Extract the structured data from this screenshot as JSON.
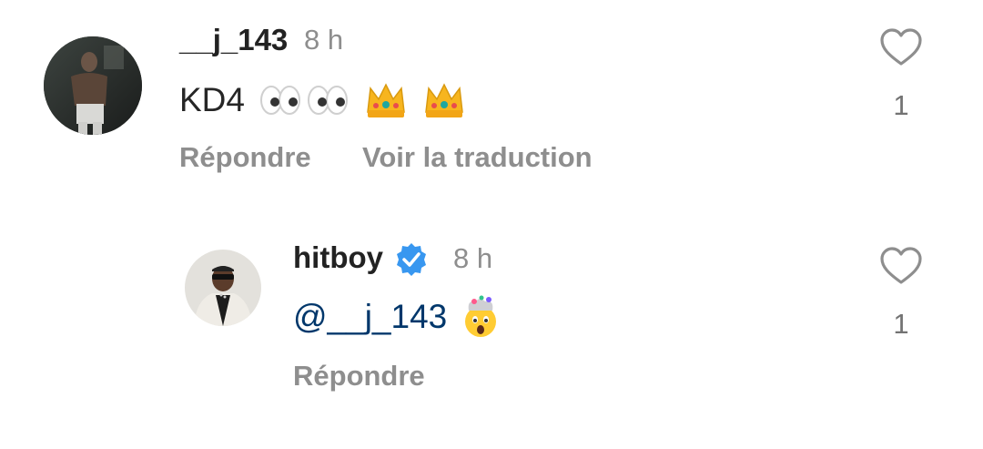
{
  "comments": [
    {
      "username": "__j_143",
      "time": "8 h",
      "text": "KD4",
      "emojis": [
        "eyes-emoji",
        "eyes-emoji",
        "crown-emoji",
        "crown-emoji"
      ],
      "reply_label": "Répondre",
      "translate_label": "Voir la traduction",
      "likes": "1",
      "verified": false
    },
    {
      "username": "hitboy",
      "time": "8 h",
      "mention": "@__j_143",
      "emojis": [
        "exploding-head-emoji"
      ],
      "reply_label": "Répondre",
      "likes": "1",
      "verified": true
    }
  ],
  "colors": {
    "username": "#222222",
    "meta": "#8e8e8e",
    "mention": "#00376b",
    "verified": "#3897f0",
    "heart_outline": "#8e8e8e"
  }
}
